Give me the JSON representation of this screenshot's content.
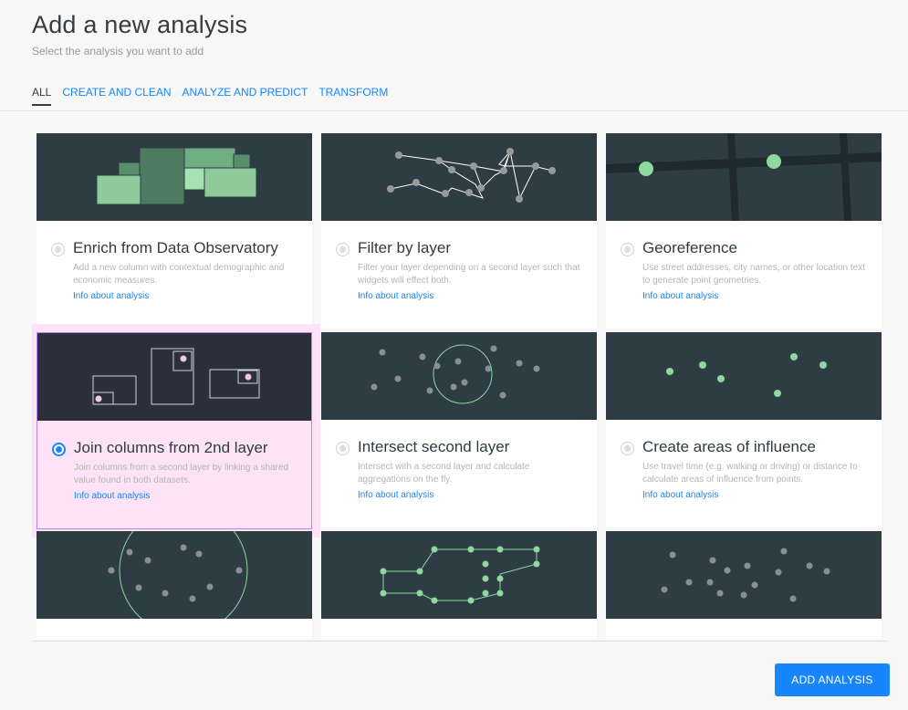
{
  "header": {
    "title": "Add a new analysis",
    "subtitle": "Select the analysis you want to add"
  },
  "tabs": [
    {
      "label": "ALL",
      "active": true
    },
    {
      "label": "CREATE AND CLEAN",
      "active": false
    },
    {
      "label": "ANALYZE AND PREDICT",
      "active": false
    },
    {
      "label": "TRANSFORM",
      "active": false
    }
  ],
  "cards": [
    {
      "title": "Enrich from Data Observatory",
      "description": "Add a new column with contextual demographic and economic measures.",
      "link": "Info about analysis",
      "selected": false
    },
    {
      "title": "Filter by layer",
      "description": "Filter your layer depending on a second layer such that widgets will effect both.",
      "link": "Info about analysis",
      "selected": false
    },
    {
      "title": "Georeference",
      "description": "Use street addresses, city names, or other location text to generate point geometries.",
      "link": "Info about analysis",
      "selected": false
    },
    {
      "title": "Join columns from 2nd layer",
      "description": "Join columns from a second layer by linking a shared value found in both datasets.",
      "link": "Info about analysis",
      "selected": true
    },
    {
      "title": "Intersect second layer",
      "description": "Intersect with a second layer and calculate aggregations on the fly.",
      "link": "Info about analysis",
      "selected": false
    },
    {
      "title": "Create areas of influence",
      "description": "Use travel time (e.g. walking or driving) or distance to calculate areas of influence from points.",
      "link": "Info about analysis",
      "selected": false
    }
  ],
  "footer": {
    "add_button": "ADD ANALYSIS"
  },
  "colors": {
    "accent": "#1785fb",
    "thumb_bg": "#2e3c43",
    "green": "#8fd8a0",
    "selected_bg": "#fde2f8"
  }
}
